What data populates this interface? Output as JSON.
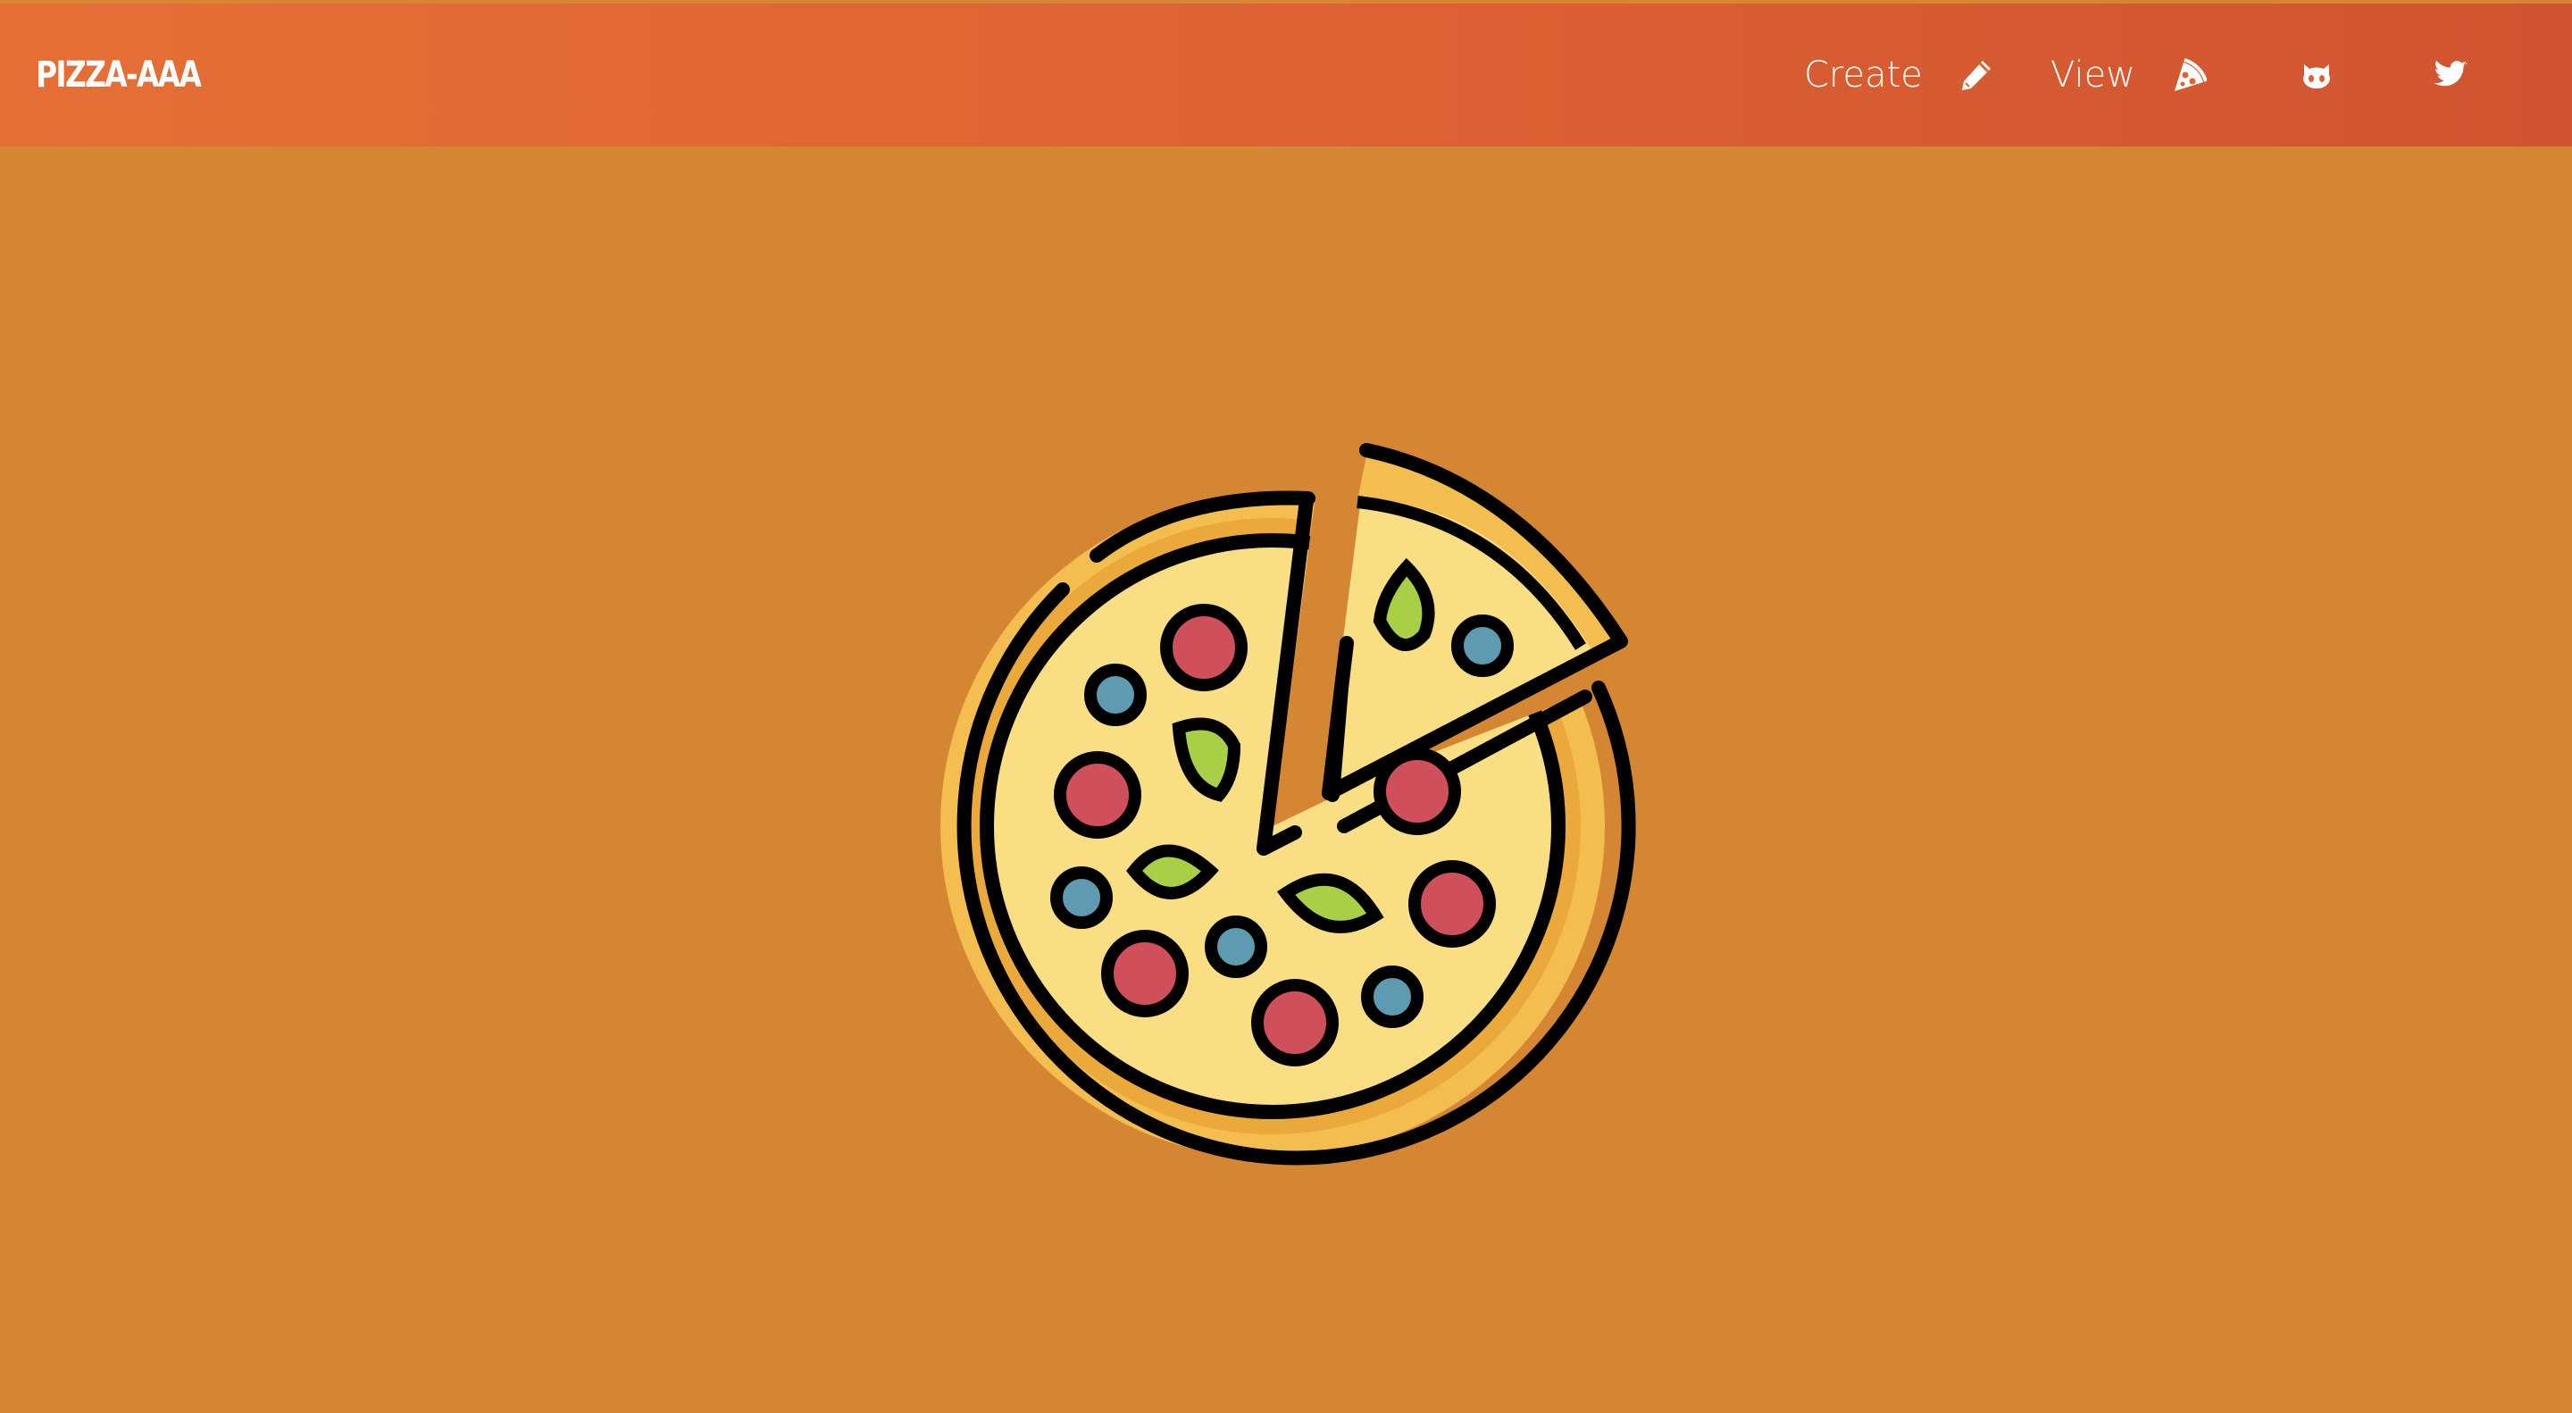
{
  "navbar": {
    "brand": "PIZZA-AAA",
    "links": [
      {
        "label": "Create",
        "icon": "pencil-icon"
      },
      {
        "label": "View",
        "icon": "pizza-slice-icon"
      }
    ],
    "social": [
      {
        "icon": "github-icon"
      },
      {
        "icon": "twitter-icon"
      }
    ]
  },
  "hero": {
    "image": "pizza-illustration"
  },
  "colors": {
    "background": "#d58632",
    "navbar_start": "#e56f35",
    "navbar_end": "#d0542f",
    "crust": "#f3be4f",
    "cheese": "#f9de84",
    "pepperoni": "#cf4f5b",
    "basil": "#a8cf45",
    "olive": "#5e9bb0",
    "outline": "#000000"
  }
}
